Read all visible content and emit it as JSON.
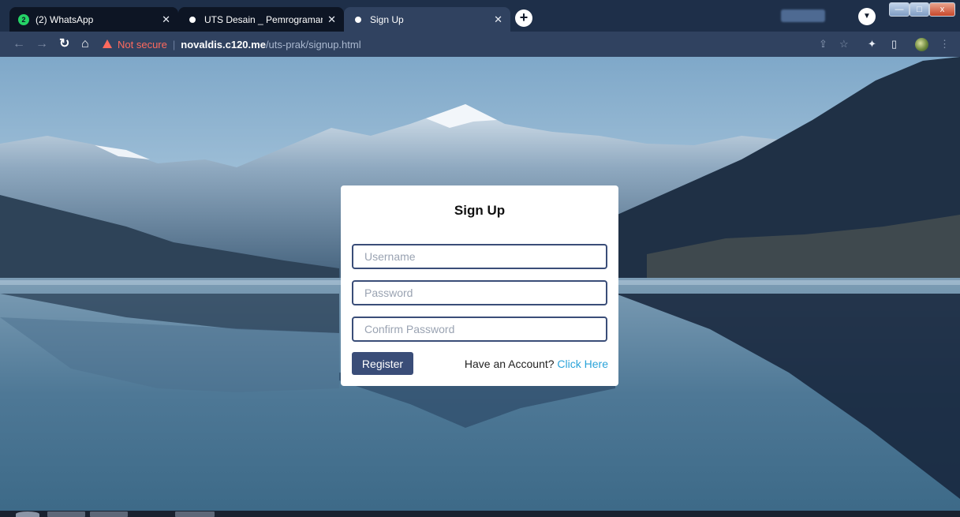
{
  "browser": {
    "tabs": [
      {
        "title": "(2) WhatsApp",
        "badge": "2",
        "favicon": "whatsapp-icon",
        "active": false
      },
      {
        "title": "UTS Desain _ Pemrograman Web",
        "favicon": "globe-icon",
        "active": false
      },
      {
        "title": "Sign Up",
        "favicon": "globe-icon",
        "active": true
      }
    ],
    "new_tab_label": "+",
    "window_controls": {
      "minimize": "—",
      "maximize": "□",
      "close": "x"
    },
    "address": {
      "security_label": "Not secure",
      "host": "novaldis.c120.me",
      "path": "/uts-prak/signup.html"
    },
    "colors": {
      "tabbar": "#1e2f49",
      "toolbar": "#304260",
      "warning": "#ff6a5e"
    }
  },
  "signup": {
    "title": "Sign Up",
    "username_placeholder": "Username",
    "password_placeholder": "Password",
    "confirm_placeholder": "Confirm Password",
    "register_label": "Register",
    "account_prompt": "Have an Account?",
    "account_link": "Click Here",
    "colors": {
      "primary": "#3a4d78",
      "link": "#2aa3d9",
      "card": "#ffffff"
    }
  }
}
